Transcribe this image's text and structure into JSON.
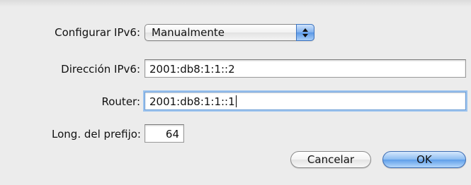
{
  "form": {
    "configure": {
      "label": "Configurar IPv6:",
      "selected": "Manualmente"
    },
    "address": {
      "label": "Dirección IPv6:",
      "value": "2001:db8:1:1::2"
    },
    "router": {
      "label": "Router:",
      "value": "2001:db8:1:1::1"
    },
    "prefix": {
      "label": "Long. del prefijo:",
      "value": "64"
    }
  },
  "buttons": {
    "cancel_label": "Cancelar",
    "ok_label": "OK"
  },
  "colors": {
    "background": "#ececec",
    "focus_ring": "#9cc3ee",
    "default_button": "#5f9ee9"
  },
  "icons": {
    "popup_arrows": "up-down-arrows-icon"
  }
}
